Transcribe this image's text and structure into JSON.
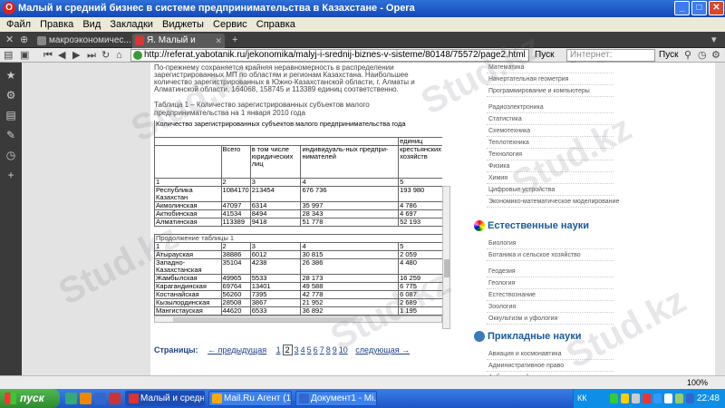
{
  "window": {
    "title": "Малый и средний бизнес в системе предпринимательства в Казахстане - Opera"
  },
  "menu": [
    "Файл",
    "Правка",
    "Вид",
    "Закладки",
    "Виджеты",
    "Сервис",
    "Справка"
  ],
  "tabs": [
    {
      "label": "макроэкономичес...",
      "active": false
    },
    {
      "label": "Я. Малый и средний ...",
      "active": true
    }
  ],
  "address": {
    "url": "http://referat.yabotanik.ru/jekonomika/malyj-i-srednij-biznes-v-sisteme/80148/75572/page2.html",
    "go": "Пуск",
    "search_placeholder": "Интернет: Поиск@m",
    "search_btn": "Пуск"
  },
  "article": {
    "para": "По-прежнему сохраняется крайняя неравномерность в распределении зарегистрированных МП по областям и регионам Казахстана. Наибольшее количество зарегистрированных в Южно-Казахстанской области, г. Алматы и Алматинской области, 164068, 158745 и 113389 единиц соответственно.",
    "caption": "Таблица 1 – Количество зарегистрированных субъектов малого предпринимательства на 1 января 2010 года",
    "table_title": "Количество зарегистрированных субъектов малого предпринимательства года",
    "unit": "единиц",
    "headers": [
      "Всего",
      "в том числе юридических лиц",
      "индивидуаль-ных предпри-нимателей",
      "крестьянских хозяйств"
    ],
    "colnums": [
      "1",
      "2",
      "3",
      "4",
      "5"
    ],
    "rows1": [
      [
        "Республика Казахстан",
        "1084170",
        "213454",
        "676 736",
        "193 980"
      ],
      [
        "Акмолинская",
        "47097",
        "6314",
        "35 997",
        "4 786"
      ],
      [
        "Актюбинская",
        "41534",
        "8494",
        "28 343",
        "4 697"
      ],
      [
        "Алматинская",
        "113389",
        "9418",
        "51 778",
        "52 193"
      ]
    ],
    "continuation": "Продолжение таблицы 1",
    "rows2": [
      [
        "Атырауская",
        "38886",
        "6012",
        "30 815",
        "2 059"
      ],
      [
        "Западно-Казахстанская",
        "35104",
        "4238",
        "26 386",
        "4 480"
      ],
      [
        "Жамбылская",
        "49965",
        "5533",
        "28 173",
        "16 259"
      ],
      [
        "Карагандинская",
        "69764",
        "13401",
        "49 588",
        "6 775"
      ],
      [
        "Костанайская",
        "56260",
        "7395",
        "42 778",
        "6 087"
      ],
      [
        "Кызылординская",
        "28508",
        "3867",
        "21 952",
        "2 689"
      ],
      [
        "Мангистауская",
        "44620",
        "6533",
        "36 892",
        "1 195"
      ]
    ]
  },
  "pager": {
    "label": "Страницы:",
    "prev": "← предыдущая",
    "pages": [
      "1",
      "2",
      "3",
      "4",
      "5",
      "6",
      "7",
      "8",
      "9",
      "10"
    ],
    "current": "2",
    "next": "следующая →"
  },
  "right": {
    "links_top": [
      "Математика",
      "Начертательная геометрия",
      "Программирование и компьютеры",
      "Радиоэлектроника",
      "Статистика",
      "Схемотехника",
      "Теплотехника",
      "Технология",
      "Физика",
      "Химия",
      "Цифровые устройства",
      "Экономико-математическое моделирование"
    ],
    "section1": "Естественные науки",
    "links_mid": [
      "Биология",
      "Ботаника и сельское хозяйство",
      "Геодезия",
      "Геология",
      "Естествознание",
      "Зоология",
      "Оккультизм и уфология"
    ],
    "section2": "Прикладные науки",
    "links_bot": [
      "Авиация и космонавтика",
      "Административное право",
      "Арбитражный процесс",
      "Валютные отношения"
    ]
  },
  "taskbar": {
    "start": "пуск",
    "tasks": [
      {
        "label": "Малый и средн...",
        "active": true
      },
      {
        "label": "Mail.Ru Агент (1...",
        "active": false
      },
      {
        "label": "Документ1 - Mi...",
        "active": false
      }
    ],
    "lang": "КК",
    "clock": "22:48"
  },
  "status": {
    "zoom": "100",
    "tooltip": "Ана"
  },
  "watermark": "Stud.kz"
}
